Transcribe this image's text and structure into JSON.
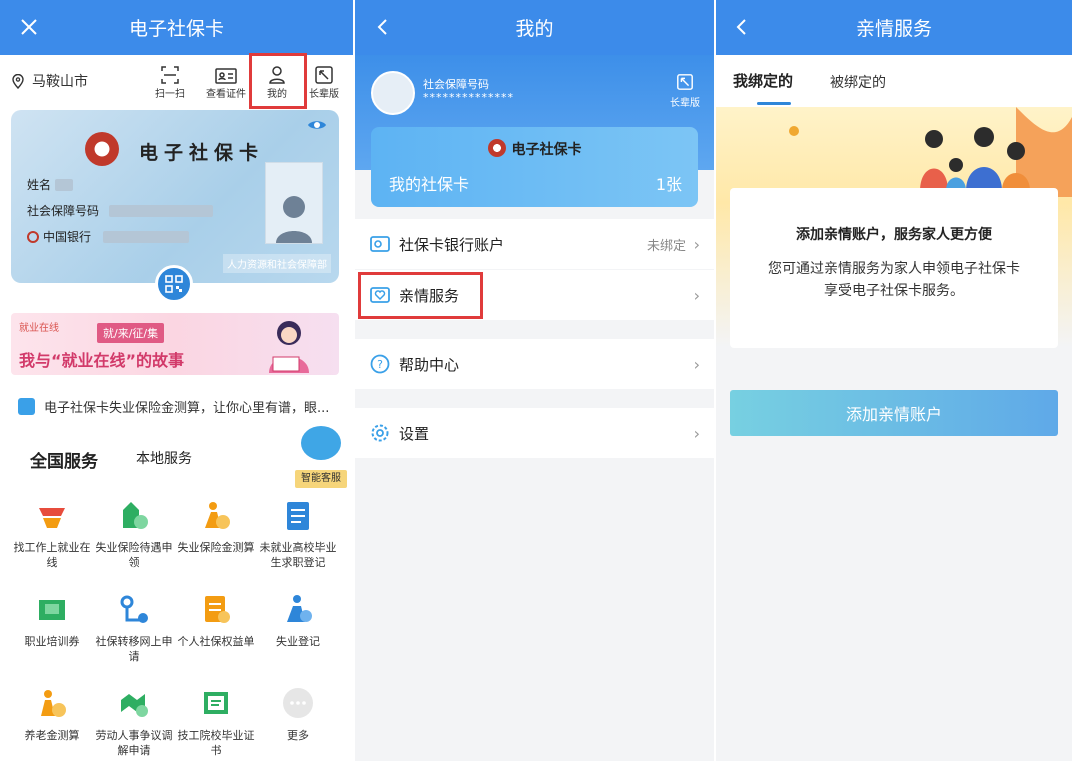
{
  "left": {
    "title": "电子社保卡",
    "city": "马鞍山市",
    "tools": [
      "扫一扫",
      "查看证件",
      "我的",
      "长辈版"
    ],
    "card": {
      "title": "电子社保卡",
      "name_label": "姓名",
      "id_label": "社会保障号码",
      "bank_label": "中国银行",
      "issuer": "人力资源和社会保障部"
    },
    "banner": {
      "logo": "就业在线",
      "tag": "就/来/征/集",
      "headline": "我与“就业在线”的故事"
    },
    "notice": "电子社保卡失业保险金测算，让你心里有谱，眼...",
    "tabs": [
      "全国服务",
      "本地服务"
    ],
    "assistant": "智能客服",
    "services": [
      {
        "label": "找工作上就业在线",
        "icon": "job-search-icon",
        "color": "#f39c12"
      },
      {
        "label": "失业保险待遇申领",
        "icon": "unemployment-benefit-icon",
        "color": "#2eae62"
      },
      {
        "label": "失业保险金测算",
        "icon": "insurance-calc-icon",
        "color": "#f39c12"
      },
      {
        "label": "未就业高校毕业生求职登记",
        "icon": "graduate-register-icon",
        "color": "#2e86d9"
      },
      {
        "label": "职业培训券",
        "icon": "training-voucher-icon",
        "color": "#2eae62"
      },
      {
        "label": "社保转移网上申请",
        "icon": "transfer-apply-icon",
        "color": "#2e86d9"
      },
      {
        "label": "个人社保权益单",
        "icon": "rights-statement-icon",
        "color": "#f39c12"
      },
      {
        "label": "失业登记",
        "icon": "unemployment-register-icon",
        "color": "#2e86d9"
      },
      {
        "label": "养老金测算",
        "icon": "pension-calc-icon",
        "color": "#f39c12"
      },
      {
        "label": "劳动人事争议调解申请",
        "icon": "dispute-mediation-icon",
        "color": "#2eae62"
      },
      {
        "label": "技工院校毕业证书",
        "icon": "diploma-icon",
        "color": "#2eae62"
      },
      {
        "label": "更多",
        "icon": "more-icon",
        "color": "#dddddd"
      }
    ]
  },
  "middle": {
    "title": "我的",
    "id_label": "社会保障号码",
    "id_masked": "**************",
    "elder_mode": "长辈版",
    "card_title": "电子社保卡",
    "my_card_label": "我的社保卡",
    "my_card_count": "1张",
    "menu": [
      {
        "label": "社保卡银行账户",
        "value": "未绑定"
      },
      {
        "label": "亲情服务",
        "value": ""
      },
      {
        "label": "帮助中心",
        "value": ""
      },
      {
        "label": "设置",
        "value": ""
      }
    ]
  },
  "right": {
    "title": "亲情服务",
    "tabs": [
      "我绑定的",
      "被绑定的"
    ],
    "card_title": "添加亲情账户，服务家人更方便",
    "card_desc_1": "您可通过亲情服务为家人申领电子社保卡",
    "card_desc_2": "享受电子社保卡服务。",
    "button": "添加亲情账户"
  }
}
